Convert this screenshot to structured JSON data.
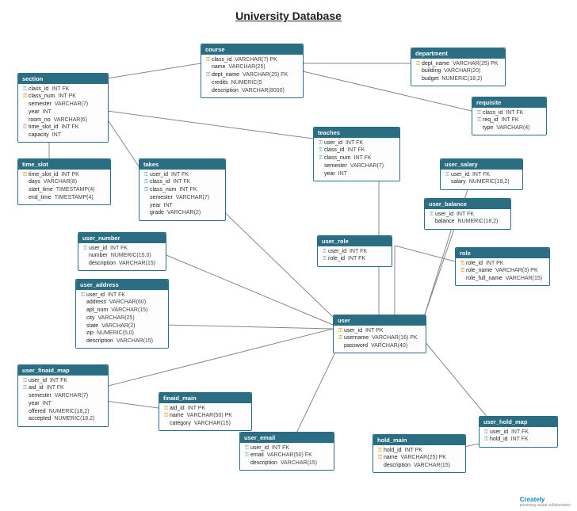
{
  "title": "University Database",
  "footer": {
    "brand": "Creately",
    "tagline": "powering visual collaboration"
  },
  "entities": {
    "section": {
      "name": "section",
      "attrs": [
        {
          "key": "fk",
          "name": "class_id",
          "type": "INT  FK"
        },
        {
          "key": "pk",
          "name": "class_num",
          "type": "INT  PK"
        },
        {
          "key": "",
          "name": "semester",
          "type": "VARCHAR(7)"
        },
        {
          "key": "",
          "name": "year",
          "type": "INT"
        },
        {
          "key": "",
          "name": "room_no",
          "type": "VARCHAR(6)"
        },
        {
          "key": "fk",
          "name": "time_slot_id",
          "type": "INT  FK"
        },
        {
          "key": "",
          "name": "capacity",
          "type": "INT"
        }
      ]
    },
    "course": {
      "name": "course",
      "attrs": [
        {
          "key": "pk",
          "name": "class_id",
          "type": "VARCHAR(7)  PK"
        },
        {
          "key": "",
          "name": "name",
          "type": "VARCHAR(25)"
        },
        {
          "key": "fk",
          "name": "dept_name",
          "type": "VARCHAR(25)  FK"
        },
        {
          "key": "",
          "name": "credits",
          "type": "NUMERIC(5"
        },
        {
          "key": "",
          "name": "description",
          "type": "VARCHAR(8000)"
        }
      ]
    },
    "department": {
      "name": "department",
      "attrs": [
        {
          "key": "pk",
          "name": "dept_name",
          "type": "VARCHAR(25)  PK"
        },
        {
          "key": "",
          "name": "building",
          "type": "VARCHAR(20)"
        },
        {
          "key": "",
          "name": "budget",
          "type": "NUMERIC(18,2)"
        }
      ]
    },
    "requisite": {
      "name": "requisite",
      "attrs": [
        {
          "key": "fk",
          "name": "class_id",
          "type": "INT  FK"
        },
        {
          "key": "fk",
          "name": "req_id",
          "type": "INT  FK"
        },
        {
          "key": "",
          "name": "type",
          "type": "VARCHAR(4)"
        }
      ]
    },
    "teaches": {
      "name": "teaches",
      "attrs": [
        {
          "key": "fk",
          "name": "user_id",
          "type": "INT  FK"
        },
        {
          "key": "fk",
          "name": "class_id",
          "type": "INT  FK"
        },
        {
          "key": "fk",
          "name": "class_num",
          "type": "INT  FK"
        },
        {
          "key": "",
          "name": "semester",
          "type": "VARCHAR(7)"
        },
        {
          "key": "",
          "name": "year",
          "type": "INT"
        }
      ]
    },
    "user_salary": {
      "name": "user_salary",
      "attrs": [
        {
          "key": "fk",
          "name": "user_id",
          "type": "INT  FK"
        },
        {
          "key": "",
          "name": "salary",
          "type": "NUMERIC(18,2)"
        }
      ]
    },
    "time_slot": {
      "name": "time_slot",
      "attrs": [
        {
          "key": "pk",
          "name": "time_slot_id",
          "type": "INT  PK"
        },
        {
          "key": "",
          "name": "days",
          "type": "VARCHAR(8)"
        },
        {
          "key": "",
          "name": "start_time",
          "type": "TIMESTAMP(4)"
        },
        {
          "key": "",
          "name": "end_time",
          "type": "TIMESTAMP(4)"
        }
      ]
    },
    "takes": {
      "name": "takes",
      "attrs": [
        {
          "key": "fk",
          "name": "user_id",
          "type": "INT  FK"
        },
        {
          "key": "fk",
          "name": "class_id",
          "type": "INT  FK"
        },
        {
          "key": "fk",
          "name": "class_num",
          "type": "INT  FK"
        },
        {
          "key": "",
          "name": "semester",
          "type": "VARCHAR(7)"
        },
        {
          "key": "",
          "name": "year",
          "type": "INT"
        },
        {
          "key": "",
          "name": "grade",
          "type": "VARCHAR(2)"
        }
      ]
    },
    "user_balance": {
      "name": "user_balance",
      "attrs": [
        {
          "key": "fk",
          "name": "user_id",
          "type": "INT  FK"
        },
        {
          "key": "",
          "name": "balance",
          "type": "NUMERIC(18,2)"
        }
      ]
    },
    "user_number": {
      "name": "user_number",
      "attrs": [
        {
          "key": "fk",
          "name": "user_id",
          "type": "INT  FK"
        },
        {
          "key": "",
          "name": "number",
          "type": "NUMERIC(15,0)"
        },
        {
          "key": "",
          "name": "description",
          "type": "VARCHAR(15)"
        }
      ]
    },
    "user_role": {
      "name": "user_role",
      "attrs": [
        {
          "key": "fk",
          "name": "user_id",
          "type": "INT  FK"
        },
        {
          "key": "fk",
          "name": "role_id",
          "type": "INT  FK"
        }
      ]
    },
    "role": {
      "name": "role",
      "attrs": [
        {
          "key": "pk",
          "name": "role_id",
          "type": "INT  PK"
        },
        {
          "key": "pk",
          "name": "role_name",
          "type": "VARCHAR(3)  PK"
        },
        {
          "key": "",
          "name": "role_full_name",
          "type": "VARCHAR(15)"
        }
      ]
    },
    "user_address": {
      "name": "user_address",
      "attrs": [
        {
          "key": "fk",
          "name": "user_id",
          "type": "INT  FK"
        },
        {
          "key": "",
          "name": "address",
          "type": "VARCHAR(60)"
        },
        {
          "key": "",
          "name": "apt_num",
          "type": "VARCHAR(15)"
        },
        {
          "key": "",
          "name": "city",
          "type": "VARCHAR(25)"
        },
        {
          "key": "",
          "name": "state",
          "type": "VARCHAR(2)"
        },
        {
          "key": "",
          "name": "zip",
          "type": "NUMERIC(5,0)"
        },
        {
          "key": "",
          "name": "description",
          "type": "VARCHAR(15)"
        }
      ]
    },
    "user": {
      "name": "user",
      "attrs": [
        {
          "key": "pk",
          "name": "user_id",
          "type": "INT  PK"
        },
        {
          "key": "pk",
          "name": "username",
          "type": "VARCHAR(16)  PK"
        },
        {
          "key": "",
          "name": "password",
          "type": "VARCHAR(40)"
        }
      ]
    },
    "user_finaid_map": {
      "name": "user_finaid_map",
      "attrs": [
        {
          "key": "fk",
          "name": "user_id",
          "type": "INT  FK"
        },
        {
          "key": "fk",
          "name": "aid_id",
          "type": "INT  FK"
        },
        {
          "key": "",
          "name": "semester",
          "type": "VARCHAR(7)"
        },
        {
          "key": "",
          "name": "year",
          "type": "INT"
        },
        {
          "key": "",
          "name": "offered",
          "type": "NUMERIC(18,2)"
        },
        {
          "key": "",
          "name": "accepted",
          "type": "NUMERIC(18,2)"
        }
      ]
    },
    "finaid_main": {
      "name": "finaid_main",
      "attrs": [
        {
          "key": "pk",
          "name": "aid_id",
          "type": "INT  PK"
        },
        {
          "key": "pk",
          "name": "name",
          "type": "VARCHAR(50)  PK"
        },
        {
          "key": "",
          "name": "category",
          "type": "VARCHAR(15)"
        }
      ]
    },
    "user_email": {
      "name": "user_email",
      "attrs": [
        {
          "key": "fk",
          "name": "user_id",
          "type": "INT  FK"
        },
        {
          "key": "fk",
          "name": "email",
          "type": "VARCHAR(50)  FK"
        },
        {
          "key": "",
          "name": "description",
          "type": "VARCHAR(15)"
        }
      ]
    },
    "hold_main": {
      "name": "hold_main",
      "attrs": [
        {
          "key": "pk",
          "name": "hold_id",
          "type": "INT  PK"
        },
        {
          "key": "pk",
          "name": "name",
          "type": "VARCHAR(25)  PK"
        },
        {
          "key": "",
          "name": "description",
          "type": "VARCHAR(15)"
        }
      ]
    },
    "user_hold_map": {
      "name": "user_hold_map",
      "attrs": [
        {
          "key": "fk",
          "name": "user_id",
          "type": "INT  FK"
        },
        {
          "key": "fk",
          "name": "hold_id",
          "type": "INT  FK"
        }
      ]
    }
  },
  "edges": [
    [
      "section",
      "course"
    ],
    [
      "section",
      "time_slot"
    ],
    [
      "section",
      "teaches"
    ],
    [
      "section",
      "takes"
    ],
    [
      "course",
      "department"
    ],
    [
      "course",
      "requisite"
    ],
    [
      "course",
      "requisite"
    ],
    [
      "teaches",
      "user"
    ],
    [
      "takes",
      "user"
    ],
    [
      "user_salary",
      "user"
    ],
    [
      "user_balance",
      "user"
    ],
    [
      "user_number",
      "user"
    ],
    [
      "user_address",
      "user"
    ],
    [
      "user_role",
      "user"
    ],
    [
      "user_role",
      "role"
    ],
    [
      "user_finaid_map",
      "user"
    ],
    [
      "user_finaid_map",
      "finaid_main"
    ],
    [
      "user_email",
      "user"
    ],
    [
      "user_hold_map",
      "user"
    ],
    [
      "user_hold_map",
      "hold_main"
    ]
  ]
}
